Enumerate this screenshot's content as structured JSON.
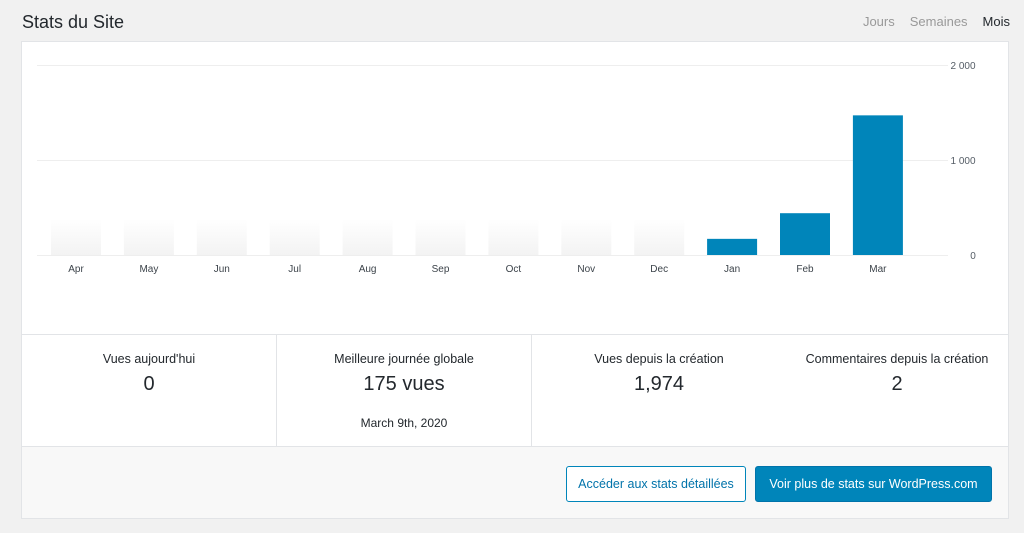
{
  "header": {
    "title": "Stats du Site",
    "period_tabs": [
      {
        "label": "Jours",
        "active": false
      },
      {
        "label": "Semaines",
        "active": false
      },
      {
        "label": "Mois",
        "active": true
      }
    ]
  },
  "chart_data": {
    "type": "bar",
    "categories": [
      "Apr",
      "May",
      "Jun",
      "Jul",
      "Aug",
      "Sep",
      "Oct",
      "Nov",
      "Dec",
      "Jan",
      "Feb",
      "Mar"
    ],
    "values": [
      0,
      0,
      0,
      0,
      0,
      0,
      0,
      0,
      0,
      170,
      440,
      1470
    ],
    "y_ticks": [
      "2 000",
      "1 000",
      "0"
    ],
    "y_tick_values": [
      2000,
      1000,
      0
    ],
    "ylim": [
      0,
      2000
    ],
    "grid": true,
    "bar_color": "#0085ba",
    "placeholder_color": "#f3f3f3"
  },
  "stats": {
    "today": {
      "label": "Vues aujourd'hui",
      "value": "0"
    },
    "best_day": {
      "label": "Meilleure journée globale",
      "value": "175 vues",
      "date": "March 9th, 2020"
    },
    "all_time_views": {
      "label": "Vues depuis la création",
      "value": "1,974"
    },
    "all_time_comments": {
      "label": "Commentaires depuis la création",
      "value": "2"
    }
  },
  "footer": {
    "detailed_stats_button": "Accéder aux stats détaillées",
    "wpcom_stats_button": "Voir plus de stats sur WordPress.com"
  }
}
